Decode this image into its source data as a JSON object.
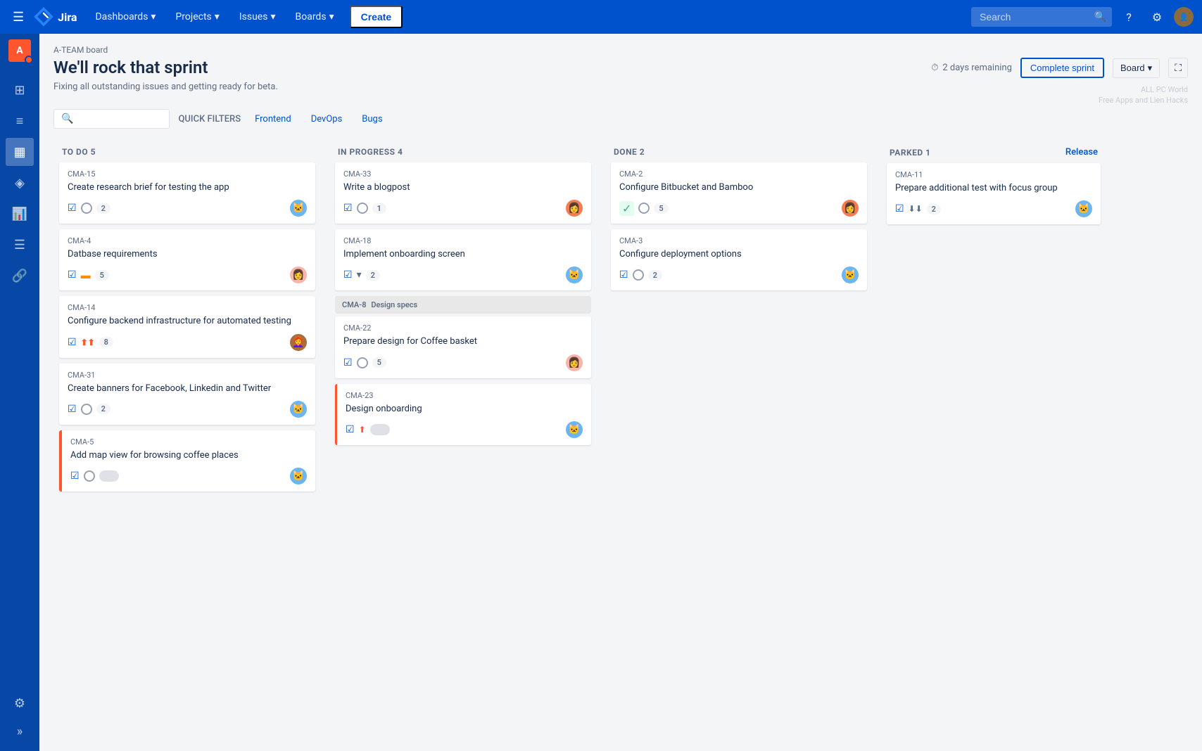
{
  "nav": {
    "brand": "Jira",
    "menu_icon_label": "☰",
    "items": [
      {
        "label": "Dashboards",
        "id": "dashboards"
      },
      {
        "label": "Projects",
        "id": "projects"
      },
      {
        "label": "Issues",
        "id": "issues"
      },
      {
        "label": "Boards",
        "id": "boards"
      }
    ],
    "create_label": "Create",
    "search_placeholder": "Search",
    "help_icon": "?",
    "settings_icon": "⚙"
  },
  "sidebar": {
    "project_abbr": "A",
    "icons": [
      {
        "name": "roadmap-icon",
        "symbol": "⊞"
      },
      {
        "name": "backlog-icon",
        "symbol": "☰"
      },
      {
        "name": "board-icon",
        "symbol": "▦"
      },
      {
        "name": "releases-icon",
        "symbol": "⬡"
      },
      {
        "name": "reports-icon",
        "symbol": "📈"
      },
      {
        "name": "pages-icon",
        "symbol": "☰"
      },
      {
        "name": "components-icon",
        "symbol": "🔗"
      },
      {
        "name": "collapse-icon",
        "symbol": "»"
      }
    ]
  },
  "board": {
    "breadcrumb": "A-TEAM board",
    "title": "We'll rock that sprint",
    "subtitle": "Fixing all outstanding issues and getting ready for beta.",
    "timer_icon": "⏱",
    "timer_text": "2 days remaining",
    "complete_sprint_label": "Complete sprint",
    "board_view_label": "Board",
    "expand_icon": "⛶"
  },
  "filters": {
    "search_placeholder": "",
    "quick_filters_label": "QUICK FILTERS",
    "tags": [
      "Frontend",
      "DevOps",
      "Bugs"
    ]
  },
  "columns": [
    {
      "id": "todo",
      "title": "TO DO 5",
      "cards": [
        {
          "id": "CMA-15",
          "title": "Create research brief for testing the app",
          "avatar": "🐱",
          "avatar_bg": "#6bb5f0",
          "has_checkbox": true,
          "has_status": true,
          "points": "2",
          "blocked": false,
          "priority_icon": null
        },
        {
          "id": "CMA-4",
          "title": "Datbase requirements",
          "avatar": "👩",
          "avatar_bg": "#f9b5ac",
          "has_checkbox": true,
          "has_status": false,
          "points": "5",
          "blocked": false,
          "priority_icon": "medium",
          "priority_symbol": "▬"
        },
        {
          "id": "CMA-14",
          "title": "Configure backend infrastructure for automated testing",
          "avatar": "👩‍🦰",
          "avatar_bg": "#aa6b3d",
          "has_checkbox": true,
          "has_status": false,
          "points": "8",
          "blocked": false,
          "priority_icon": "high",
          "priority_symbol": "⬆⬆"
        },
        {
          "id": "CMA-31",
          "title": "Create banners for Facebook, Linkedin and Twitter",
          "avatar": "🐱",
          "avatar_bg": "#6bb5f0",
          "has_checkbox": true,
          "has_status": true,
          "points": "2",
          "blocked": false,
          "priority_icon": null
        },
        {
          "id": "CMA-5",
          "title": "Add map view for browsing coffee places",
          "avatar": "🐱",
          "avatar_bg": "#6bb5f0",
          "has_checkbox": true,
          "has_status": true,
          "has_toggle": true,
          "points": null,
          "blocked": true,
          "priority_icon": null
        }
      ]
    },
    {
      "id": "inprogress",
      "title": "IN PROGRESS 4",
      "cards": [
        {
          "id": "CMA-33",
          "title": "Write a blogpost",
          "avatar": "👩",
          "avatar_bg": "#f57b51",
          "has_checkbox": true,
          "has_status": true,
          "points": "1",
          "blocked": false,
          "group": null
        },
        {
          "id": "CMA-18",
          "title": "Implement onboarding screen",
          "avatar": "🐱",
          "avatar_bg": "#6bb5f0",
          "has_checkbox": true,
          "has_status": false,
          "points": "2",
          "blocked": false,
          "priority_icon": "down",
          "priority_symbol": "▼"
        },
        {
          "id": "CMA-8",
          "epic_name": "Design specs",
          "sub_cards": [
            {
              "id": "CMA-22",
              "title": "Prepare design for Coffee basket",
              "avatar": "👩",
              "avatar_bg": "#f9b5ac",
              "has_checkbox": true,
              "has_status": true,
              "points": "5"
            },
            {
              "id": "CMA-23",
              "title": "Design onboarding",
              "avatar": "🐱",
              "avatar_bg": "#6bb5f0",
              "has_checkbox": true,
              "has_status": false,
              "has_toggle": true,
              "priority_icon": "high",
              "priority_symbol": "⬆",
              "points": null
            }
          ]
        }
      ]
    },
    {
      "id": "done",
      "title": "DONE 2",
      "cards": [
        {
          "id": "CMA-2",
          "title": "Configure Bitbucket and Bamboo",
          "avatar": "👩",
          "avatar_bg": "#f57b51",
          "has_checkbox": false,
          "has_status_green": true,
          "has_status": true,
          "points": "5",
          "blocked": false
        },
        {
          "id": "CMA-3",
          "title": "Configure deployment options",
          "avatar": "🐱",
          "avatar_bg": "#6bb5f0",
          "has_checkbox": true,
          "has_status": true,
          "points": "2",
          "blocked": false
        }
      ]
    },
    {
      "id": "parked",
      "title": "PARKED 1",
      "release_label": "Release",
      "cards": [
        {
          "id": "CMA-11",
          "title": "Prepare additional test with focus group",
          "avatar": "🐱",
          "avatar_bg": "#6bb5f0",
          "has_checkbox": true,
          "has_status": false,
          "priority_icon": "lowest",
          "priority_symbol": "⬇⬇",
          "points": "2",
          "blocked": false
        }
      ]
    }
  ],
  "watermark": {
    "line1": "ALL PC World",
    "line2": "Free Apps and Lien Hacks"
  }
}
